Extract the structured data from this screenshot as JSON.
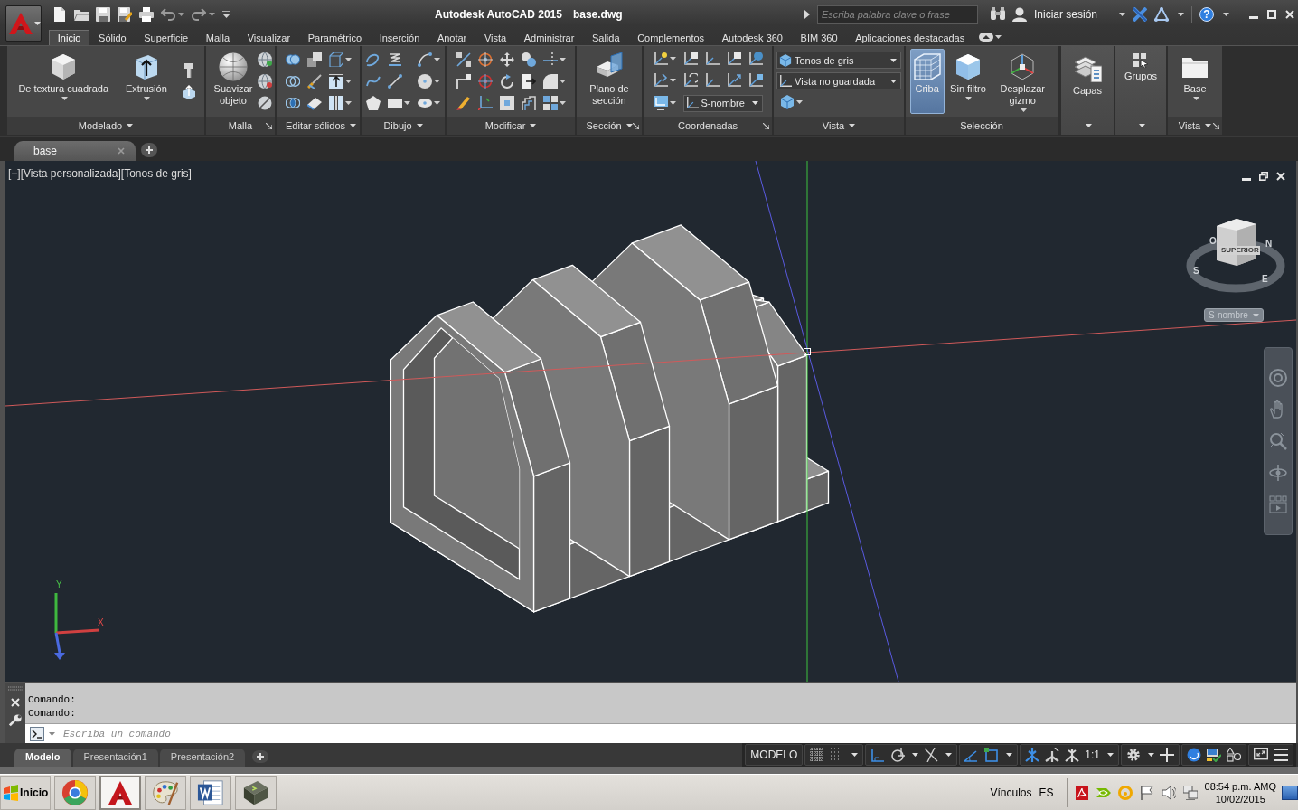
{
  "title_bar": {
    "title": "Autodesk AutoCAD 2015",
    "filename": "base.dwg",
    "search": {
      "placeholder": "Escriba palabra clave o frase"
    },
    "sign_in": "Iniciar sesión",
    "help": "?"
  },
  "ribbon_tabs": [
    {
      "label": "Inicio",
      "selected": true
    },
    {
      "label": "Sólido",
      "selected": false
    },
    {
      "label": "Superficie",
      "selected": false
    },
    {
      "label": "Malla",
      "selected": false
    },
    {
      "label": "Visualizar",
      "selected": false
    },
    {
      "label": "Paramétrico",
      "selected": false
    },
    {
      "label": "Inserción",
      "selected": false
    },
    {
      "label": "Anotar",
      "selected": false
    },
    {
      "label": "Vista",
      "selected": false
    },
    {
      "label": "Administrar",
      "selected": false
    },
    {
      "label": "Salida",
      "selected": false
    },
    {
      "label": "Complementos",
      "selected": false
    },
    {
      "label": "Autodesk 360",
      "selected": false
    },
    {
      "label": "BIM 360",
      "selected": false
    },
    {
      "label": "Aplicaciones destacadas",
      "selected": false
    }
  ],
  "ribbon_panels": [
    {
      "kind": "panel",
      "title": "Modelado",
      "menu": true,
      "launcher": false,
      "buttons": [
        {
          "label": "De textura cuadrada",
          "dropdown": true
        },
        {
          "label": "Extrusión",
          "dropdown": true
        }
      ]
    },
    {
      "kind": "panel",
      "title": "Malla",
      "menu": false,
      "launcher": true,
      "buttons": [
        {
          "label": "Suavizar objeto",
          "dropdown": false
        }
      ]
    },
    {
      "kind": "panel",
      "title": "Editar sólidos",
      "menu": true,
      "launcher": false
    },
    {
      "kind": "panel",
      "title": "Dibujo",
      "menu": true,
      "launcher": false
    },
    {
      "kind": "panel",
      "title": "Modificar",
      "menu": true,
      "launcher": false
    },
    {
      "kind": "panel",
      "title": "Sección",
      "menu": true,
      "launcher": true,
      "buttons": [
        {
          "label": "Plano de sección",
          "dropdown": false
        }
      ]
    },
    {
      "kind": "panel",
      "title": "Coordenadas",
      "menu": false,
      "launcher": true,
      "dropdowns": [
        {
          "value": "S-nombre"
        }
      ]
    },
    {
      "kind": "panel",
      "title": "Vista",
      "menu": true,
      "launcher": false,
      "dropdowns": [
        {
          "value": "Tonos de gris"
        },
        {
          "value": "Vista no guardada"
        }
      ]
    },
    {
      "kind": "panel",
      "title": "Selección",
      "menu": false,
      "launcher": false,
      "buttons": [
        {
          "label": "Criba",
          "dropdown": false,
          "on": true
        },
        {
          "label": "Sin filtro",
          "dropdown": true,
          "on": false
        },
        {
          "label": "Desplazar gizmo",
          "dropdown": true,
          "on": false
        }
      ]
    },
    {
      "kind": "collapsed",
      "label": "Capas"
    },
    {
      "kind": "collapsed",
      "label": "Grupos"
    },
    {
      "kind": "panel",
      "title": "Vista",
      "menu": true,
      "launcher": true,
      "buttons": [
        {
          "label": "Base",
          "dropdown": true
        }
      ]
    }
  ],
  "file_tabs": [
    {
      "label": "base"
    }
  ],
  "viewport": {
    "label": "[−][Vista personalizada][Tonos de gris]",
    "viewcube": {
      "face": "SUPERIOR",
      "compass": [
        "O",
        "N",
        "S",
        "E"
      ],
      "ucs_menu": "S-nombre"
    },
    "ucs_icon": {
      "y_label": "Y",
      "x_label": "X"
    }
  },
  "command_line": {
    "history": [
      "Comando:",
      "Comando:"
    ],
    "placeholder": "Escriba un comando"
  },
  "layout_tabs": [
    {
      "label": "Modelo",
      "selected": true
    },
    {
      "label": "Presentación1",
      "selected": false
    },
    {
      "label": "Presentación2",
      "selected": false
    }
  ],
  "status_bar": {
    "space": "MODELO",
    "toggles": [
      {
        "on": false
      },
      {
        "on": false
      },
      {
        "on": true
      },
      {
        "on": false
      },
      {
        "on": false
      },
      {
        "on": true
      },
      {
        "on": true
      },
      {
        "on": true
      },
      {
        "on": false
      }
    ],
    "scale": "1:1"
  },
  "taskbar": {
    "start": "Inicio",
    "apps": [
      {
        "selected": false
      },
      {
        "selected": true
      },
      {
        "selected": false
      },
      {
        "selected": false
      },
      {
        "selected": false
      }
    ],
    "links": "Vínculos",
    "language": "ES",
    "time": "08:54 p.m. AMQ",
    "date": "10/02/2015"
  }
}
